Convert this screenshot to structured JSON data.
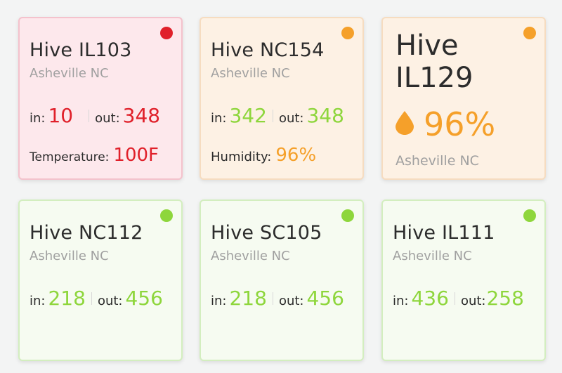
{
  "colors": {
    "alert": "#e0202a",
    "warning": "#f5a02a",
    "ok": "#8ed63c"
  },
  "cards": [
    {
      "title": "Hive IL103",
      "location": "Asheville NC",
      "in_label": "in:",
      "in_value": "10",
      "out_label": "out:",
      "out_value": "348",
      "metric_label": "Temperature:",
      "metric_value": "100F",
      "status": "red"
    },
    {
      "title": "Hive NC154",
      "location": "Asheville NC",
      "in_label": "in:",
      "in_value": "342",
      "out_label": "out:",
      "out_value": "348",
      "metric_label": "Humidity:",
      "metric_value": "96%",
      "status": "orange"
    },
    {
      "title_line1": "Hive",
      "title_line2": "IL129",
      "metric_icon": "droplet-icon",
      "metric_value": "96%",
      "location": "Asheville NC",
      "status": "orange"
    },
    {
      "title": "Hive NC112",
      "location": "Asheville NC",
      "in_label": "in:",
      "in_value": "218",
      "out_label": "out:",
      "out_value": "456",
      "status": "green"
    },
    {
      "title": "Hive SC105",
      "location": "Asheville NC",
      "in_label": "in:",
      "in_value": "218",
      "out_label": "out:",
      "out_value": "456",
      "status": "green"
    },
    {
      "title": "Hive IL111",
      "location": "Asheville NC",
      "in_label": "in:",
      "in_value": "436",
      "out_label": "out:",
      "out_value": "258",
      "status": "green"
    }
  ]
}
